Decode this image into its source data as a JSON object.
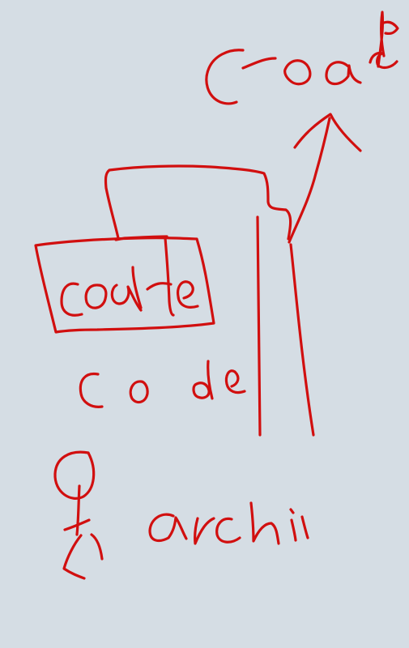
{
  "canvas": {
    "background": "#d5dde4",
    "ink_color": "#d10f0f"
  },
  "handwriting": {
    "top_right": "coar",
    "box_label": "code",
    "below_box": "code",
    "bottom_label": "archi"
  },
  "icons": {
    "person": "stick-figure",
    "arrow": "upward-arrow"
  }
}
